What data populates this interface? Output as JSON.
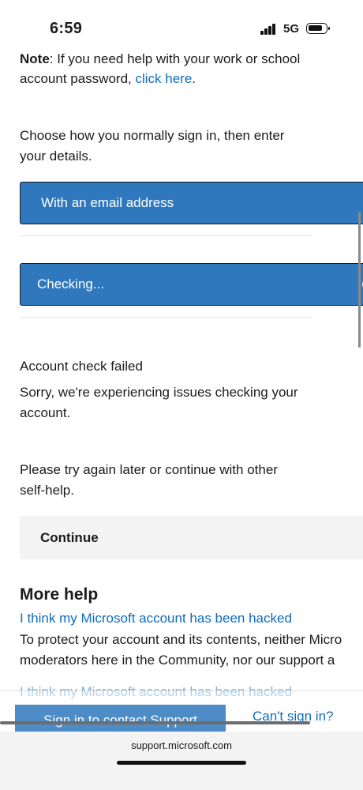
{
  "status_bar": {
    "time": "6:59",
    "network": "5G"
  },
  "intro": {
    "note_prefix": "Note",
    "note_text": ": If you need help with your work or school",
    "password_text": "account password, ",
    "click_here": "click here",
    "period": "."
  },
  "choose": {
    "line1": "Choose how you normally sign in, then enter",
    "line2": "your details."
  },
  "email_button": {
    "label": "With an email address"
  },
  "checking_button": {
    "label": "Checking..."
  },
  "error": {
    "title": "Account check failed",
    "line1": "Sorry, we're experiencing issues checking your",
    "line2": "account."
  },
  "retry": {
    "line1": "Please try again later or continue with other",
    "line2": "self-help."
  },
  "continue_button": {
    "label": "Continue"
  },
  "more_help": {
    "heading": "More help",
    "link1": "I think my Microsoft account has been hacked",
    "desc_line1": "To protect your account and its contents, neither Micro",
    "desc_line2": "moderators here in the Community, nor our support a",
    "link2": "I think my Microsoft account has been hacked"
  },
  "footer": {
    "sign_in_button": "Sign in to contact Support",
    "cant_sign_in": "Can't sign in?"
  },
  "browser": {
    "url": "support.microsoft.com"
  },
  "colors": {
    "primary_blue": "#2f78bd",
    "link_blue": "#0f6cbd",
    "grey_button": "#f3f3f3"
  }
}
